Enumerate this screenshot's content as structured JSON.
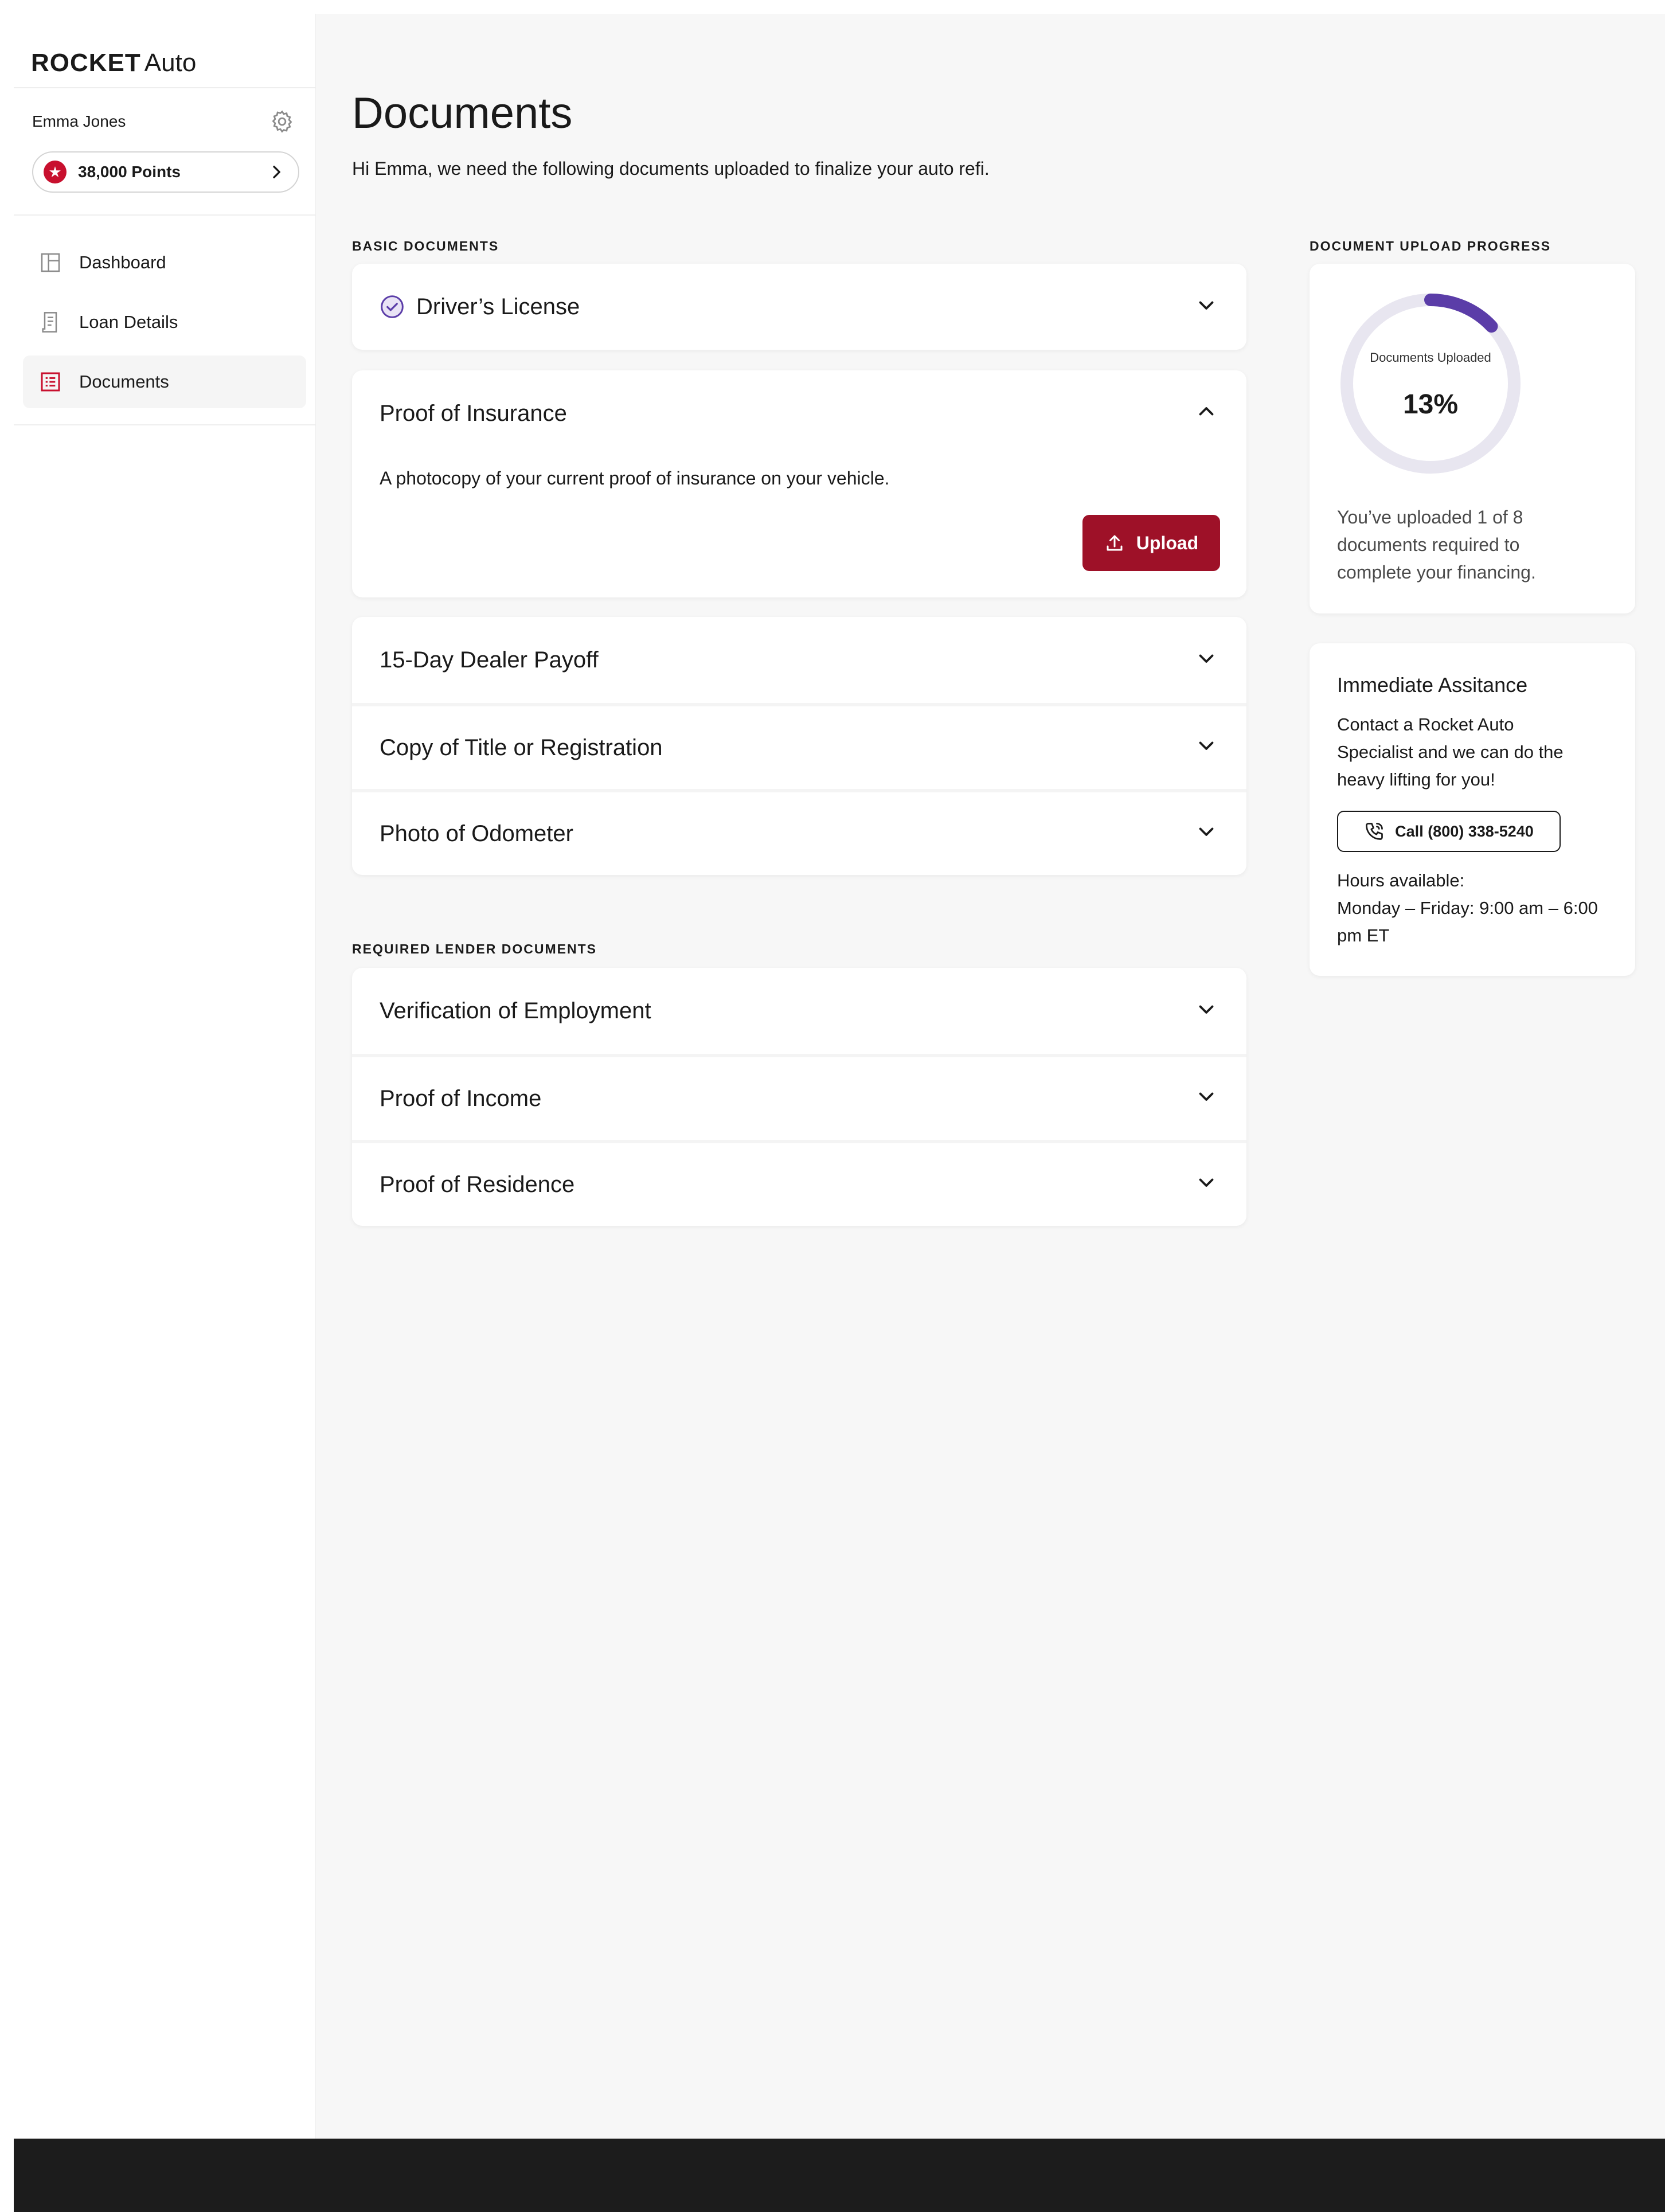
{
  "brand": {
    "logo_strong": "ROCKET",
    "logo_light": "Auto",
    "accent": "#c8102e",
    "button_color": "#9e1128",
    "progress_color": "#5b3da8"
  },
  "user": {
    "name": "Emma Jones",
    "points_label": "38,000 Points"
  },
  "nav": {
    "items": [
      {
        "label": "Dashboard",
        "icon": "dashboard-icon",
        "active": false
      },
      {
        "label": "Loan Details",
        "icon": "receipt-icon",
        "active": false
      },
      {
        "label": "Documents",
        "icon": "documents-icon",
        "active": true
      }
    ]
  },
  "page": {
    "title": "Documents",
    "subtitle": "Hi Emma, we need the following documents uploaded to finalize your auto refi."
  },
  "basic": {
    "label": "BASIC DOCUMENTS",
    "items": [
      {
        "title": "Driver’s License",
        "status": "uploaded"
      },
      {
        "title": "Proof of Insurance",
        "expanded": true,
        "description": "A photocopy of your current proof of insurance on your vehicle.",
        "button": "Upload"
      },
      {
        "title": "15-Day Dealer Payoff"
      },
      {
        "title": "Copy of Title or Registration"
      },
      {
        "title": "Photo of Odometer"
      }
    ]
  },
  "lender": {
    "label": "REQUIRED LENDER DOCUMENTS",
    "items": [
      {
        "title": "Verification of Employment"
      },
      {
        "title": "Proof of Income"
      },
      {
        "title": "Proof of Residence"
      }
    ]
  },
  "progress": {
    "label": "DOCUMENT UPLOAD PROGRESS",
    "ring_label": "Documents Uploaded",
    "percent_text": "13%",
    "fraction": 0.13,
    "description": "You’ve uploaded 1 of 8 documents required to complete your financing."
  },
  "assist": {
    "title": "Immediate Assitance",
    "body": "Contact a Rocket Auto Specialist and we can do the heavy lifting for you!",
    "call_label": "Call (800) 338-5240",
    "hours_title": "Hours available:",
    "hours_value": "Monday – Friday: 9:00 am – 6:00 pm ET"
  }
}
